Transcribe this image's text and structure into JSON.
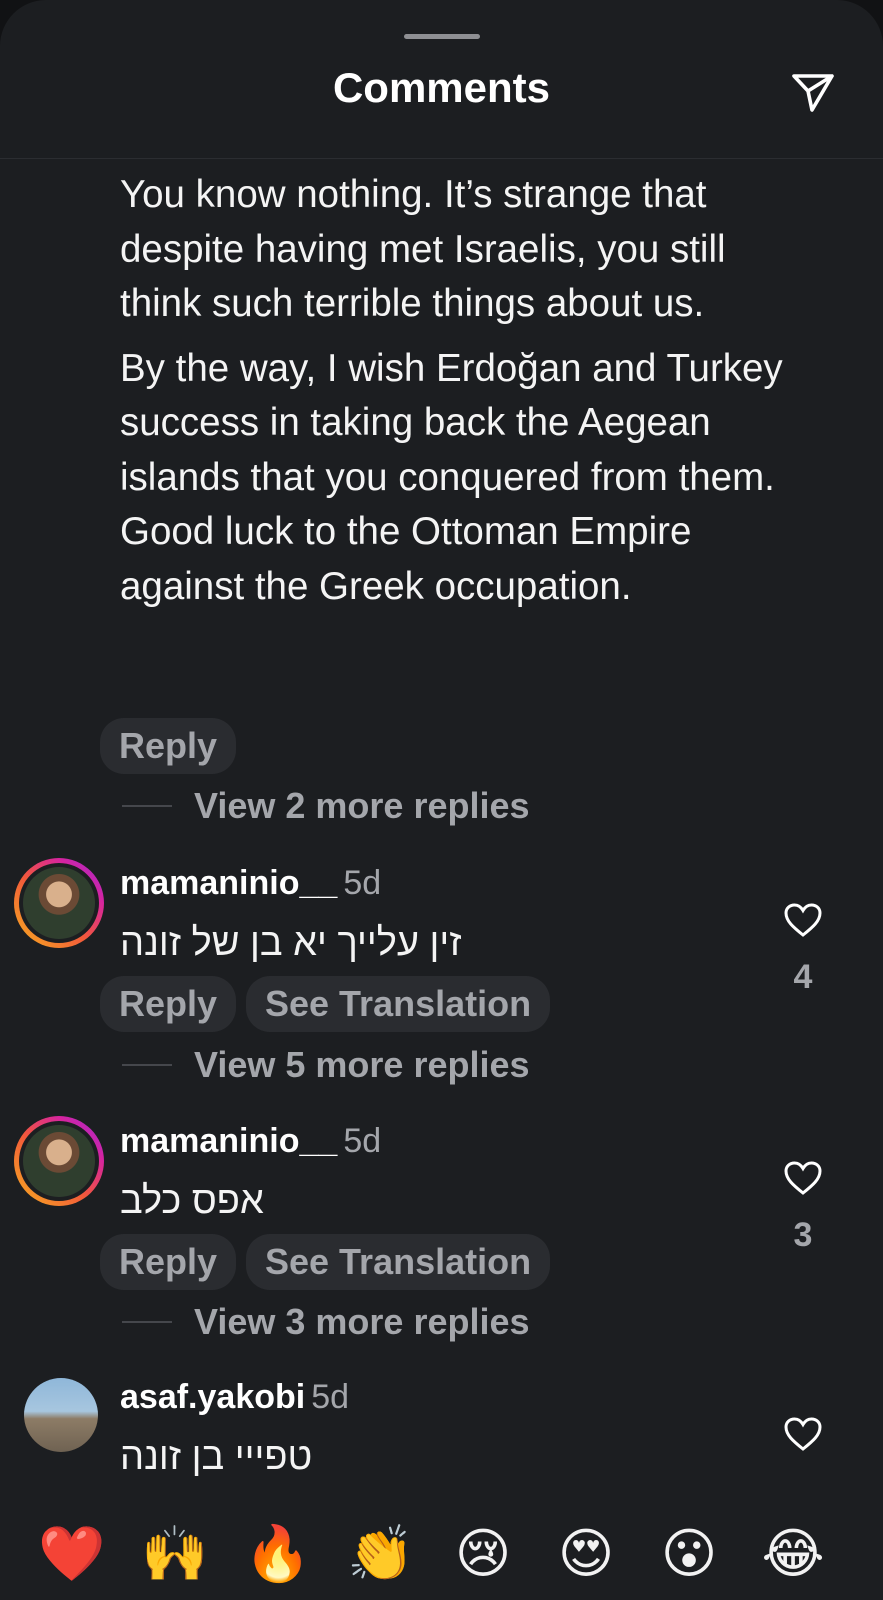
{
  "header": {
    "title": "Comments",
    "share_icon": "paper-plane-icon"
  },
  "top_comment": {
    "paragraph_1": "You know nothing. It’s strange that despite having met Israelis, you still think such terrible things about us.",
    "paragraph_2": "By the way, I wish Erdoğan and Turkey success in taking back the Aegean islands that you conquered from them. Good luck to the Ottoman Empire against the Greek occupation.",
    "reply_label": "Reply",
    "view_more": "View 2 more replies"
  },
  "comments": [
    {
      "username": "mamaninio__",
      "time": "5d",
      "text": "זין עלייך יא בן של זונה",
      "reply_label": "Reply",
      "translate_label": "See Translation",
      "likes": "4",
      "view_more": "View 5 more replies"
    },
    {
      "username": "mamaninio__",
      "time": "5d",
      "text": "אפס כלב",
      "reply_label": "Reply",
      "translate_label": "See Translation",
      "likes": "3",
      "view_more": "View 3 more replies"
    },
    {
      "username": "asaf.yakobi",
      "time": "5d",
      "text": "טפייי בן זונה"
    }
  ],
  "emoji_bar": [
    "❤️",
    "🙌",
    "🔥",
    "👏",
    "😢",
    "😍",
    "😮",
    "😂"
  ],
  "colors": {
    "background": "#1c1e21",
    "secondary_text": "#a4a6ab",
    "pill_background": "#2a2c30"
  }
}
